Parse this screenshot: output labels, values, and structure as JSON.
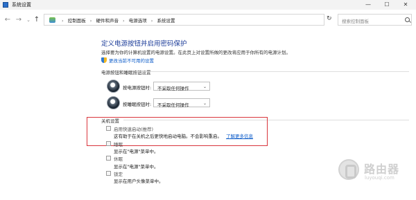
{
  "window": {
    "title": "系统设置",
    "min_label": "—",
    "max_label": "☐",
    "close_label": "✕"
  },
  "nav": {
    "back": "←",
    "forward": "→",
    "dropdown": "⌄",
    "up": "↑",
    "breadcrumbs": [
      "控制面板",
      "硬件和声音",
      "电源选项",
      "系统设置"
    ],
    "crumb_separator": "›",
    "address_dropdown": "⌄",
    "refresh": "↻",
    "search_placeholder": "搜索控制面板"
  },
  "page": {
    "title": "定义电源按钮并启用密码保护",
    "intro": "选择要为你的计算机设置的电源设置。在此页上对设置所做的更改将应用于你所有的电源计划。",
    "change_link": "更改当前不可用的设置"
  },
  "power_buttons": {
    "section_label": "电源按钮和睡眠按钮设置",
    "rows": [
      {
        "label": "按电源按钮时:",
        "value": "不采取任何操作"
      },
      {
        "label": "按睡眠按钮时:",
        "value": "不采取任何操作"
      }
    ]
  },
  "shutdown": {
    "section_label": "关机设置",
    "options": [
      {
        "label": "启用快速启动(推荐)",
        "description": "这有助于在关机之后更快地启动电脑。不会影响重启。",
        "link": "了解更多信息",
        "checked": false
      },
      {
        "label": "睡眠",
        "description": "显示在\"电源\"菜单中。",
        "checked": false
      },
      {
        "label": "休眠",
        "description": "显示在\"电源\"菜单中。",
        "checked": false
      },
      {
        "label": "锁定",
        "description": "显示在用户头像菜单中。",
        "checked": false
      }
    ]
  },
  "watermark": {
    "title": "路由器",
    "subtitle": "luyouqi.com"
  },
  "colors": {
    "title_blue": "#1e3e9a",
    "link_blue": "#0b5bc9",
    "highlight_red": "#d9343b"
  }
}
